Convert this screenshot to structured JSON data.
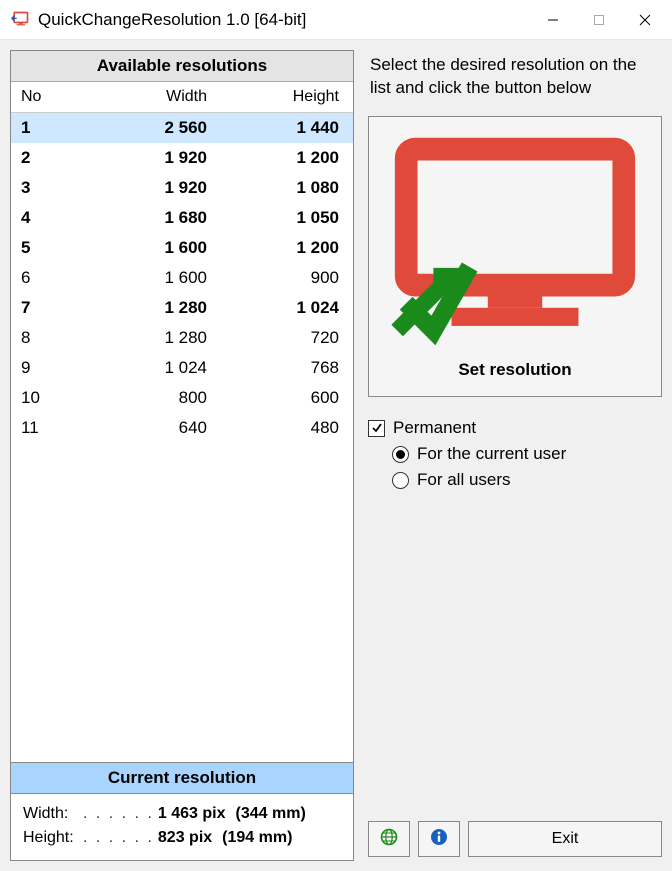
{
  "window": {
    "title": "QuickChangeResolution 1.0  [64-bit]"
  },
  "panels": {
    "available_header": "Available resolutions",
    "current_header": "Current resolution"
  },
  "table": {
    "headers": {
      "no": "No",
      "width": "Width",
      "height": "Height"
    },
    "rows": [
      {
        "no": "1",
        "width": "2 560",
        "height": "1 440",
        "bold": true,
        "selected": true
      },
      {
        "no": "2",
        "width": "1 920",
        "height": "1 200",
        "bold": true,
        "selected": false
      },
      {
        "no": "3",
        "width": "1 920",
        "height": "1 080",
        "bold": true,
        "selected": false
      },
      {
        "no": "4",
        "width": "1 680",
        "height": "1 050",
        "bold": true,
        "selected": false
      },
      {
        "no": "5",
        "width": "1 600",
        "height": "1 200",
        "bold": true,
        "selected": false
      },
      {
        "no": "6",
        "width": "1 600",
        "height": "900",
        "bold": false,
        "selected": false
      },
      {
        "no": "7",
        "width": "1 280",
        "height": "1 024",
        "bold": true,
        "selected": false
      },
      {
        "no": "8",
        "width": "1 280",
        "height": "720",
        "bold": false,
        "selected": false
      },
      {
        "no": "9",
        "width": "1 024",
        "height": "768",
        "bold": false,
        "selected": false
      },
      {
        "no": "10",
        "width": "800",
        "height": "600",
        "bold": false,
        "selected": false
      },
      {
        "no": "11",
        "width": "640",
        "height": "480",
        "bold": false,
        "selected": false
      }
    ]
  },
  "current": {
    "width_label": "Width:",
    "width_value": "1 463 pix",
    "width_mm": "(344 mm)",
    "height_label": "Height:",
    "height_value": "823 pix",
    "height_mm": "(194 mm)"
  },
  "right": {
    "instruction": "Select the desired resolution on the list and click the button below",
    "set_button": "Set resolution",
    "permanent": "Permanent",
    "current_user": "For the current user",
    "all_users": "For all users",
    "exit": "Exit"
  },
  "state": {
    "permanent_checked": true,
    "radio_selected": "current_user"
  },
  "colors": {
    "selected_row": "#cfe8ff",
    "current_header_bg": "#a8d4ff",
    "monitor_outline": "#e04a3a",
    "check_green": "#1a8a1a",
    "globe": "#1a8a1a",
    "info": "#1860c0"
  }
}
